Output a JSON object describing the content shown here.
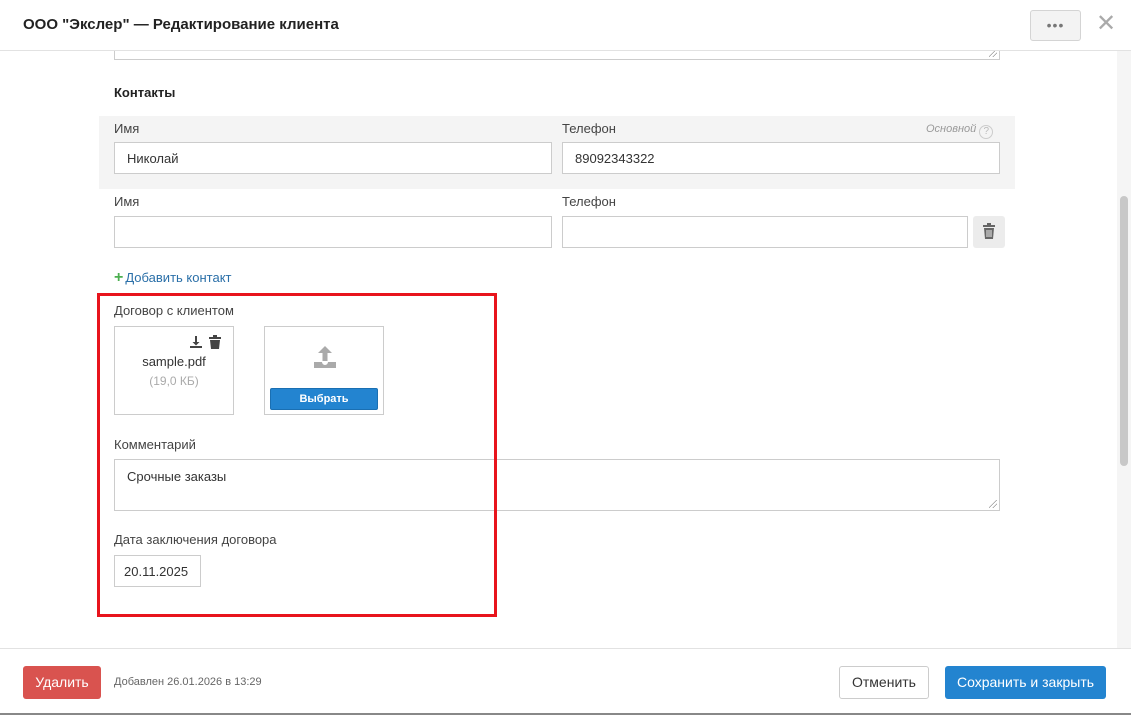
{
  "header": {
    "title": "ООО \"Экслер\" — Редактирование клиента",
    "more_label": "•••",
    "close_label": "✕"
  },
  "contacts": {
    "section_title": "Контакты",
    "primary_label": "Основной",
    "help_label": "?",
    "rows": [
      {
        "name_label": "Имя",
        "phone_label": "Телефон",
        "name_value": "Николай",
        "phone_value": "89092343322"
      },
      {
        "name_label": "Имя",
        "phone_label": "Телефон",
        "name_value": "",
        "phone_value": ""
      }
    ],
    "add_label": "Добавить контакт"
  },
  "contract": {
    "label": "Договор с клиентом",
    "file_name": "sample.pdf",
    "file_size": "(19,0 КБ)",
    "choose_label": "Выбрать"
  },
  "comment": {
    "label": "Комментарий",
    "value": "Срочные заказы"
  },
  "contract_date": {
    "label": "Дата заключения договора",
    "value": "20.11.2025"
  },
  "footer": {
    "delete_label": "Удалить",
    "added_info": "Добавлен 26.01.2026 в 13:29",
    "cancel_label": "Отменить",
    "save_label": "Сохранить и закрыть"
  },
  "colors": {
    "primary": "#2384d0",
    "danger": "#d9534f",
    "highlight": "#e8141c",
    "link": "#2a6fa8",
    "add_plus": "#4caf50"
  }
}
